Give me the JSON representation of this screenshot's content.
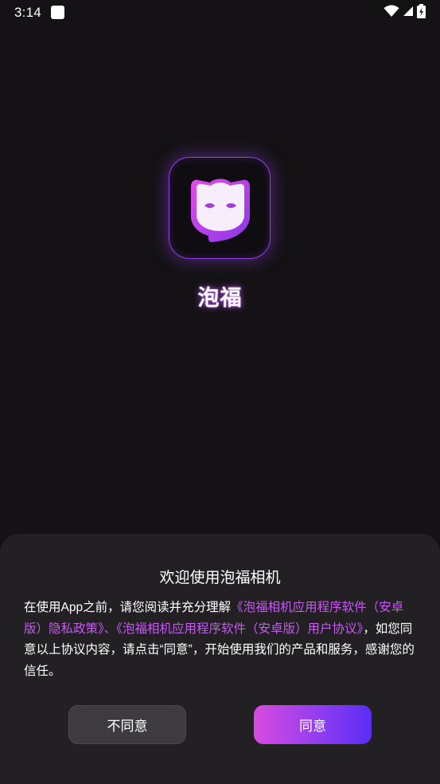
{
  "status_bar": {
    "time": "3:14",
    "icons": [
      "notification-square-icon",
      "wifi-icon",
      "signal-icon",
      "battery-charging-icon"
    ]
  },
  "app": {
    "name": "泡福",
    "icon": "mask-icon",
    "brand_colors": {
      "purple": "#8f3fe0",
      "pink": "#d84be0",
      "blue_violet": "#5a2df5",
      "link": "#c45cf0"
    }
  },
  "dialog": {
    "title": "欢迎使用泡福相机",
    "body": {
      "intro": "在使用App之前，请您阅读并充分理解",
      "privacy_link": "《泡福相机应用程序软件（安卓版）隐私政策》",
      "separator": "、",
      "agreement_link": "《泡福相机应用程序软件（安卓版）用户协议》",
      "outro": "，如您同意以上协议内容，请点击“同意”，开始使用我们的产品和服务，感谢您的信任。"
    },
    "buttons": {
      "disagree": "不同意",
      "agree": "同意"
    }
  }
}
